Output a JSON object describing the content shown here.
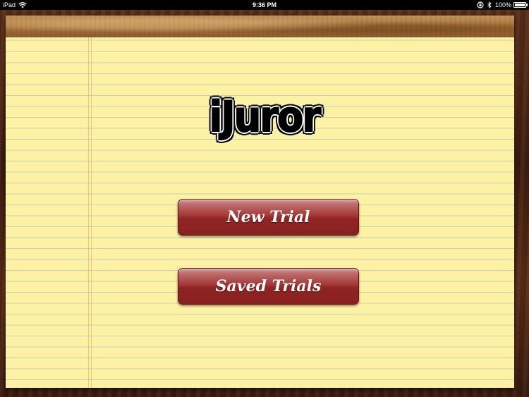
{
  "status_bar": {
    "carrier": "iPad",
    "time": "9:36 PM",
    "battery_percent": "100%",
    "battery_level": 1.0,
    "icons": [
      "wifi-icon",
      "rotation-lock-icon",
      "bluetooth-icon",
      "battery-icon"
    ]
  },
  "app": {
    "logo_text": "iJuror"
  },
  "menu": {
    "new_trial_label": "New Trial",
    "saved_trials_label": "Saved Trials"
  },
  "colors": {
    "paper": "#fdf2a4",
    "button": "#a43838",
    "margin_line": "#e69678",
    "rule_line": "#96b9c8"
  }
}
